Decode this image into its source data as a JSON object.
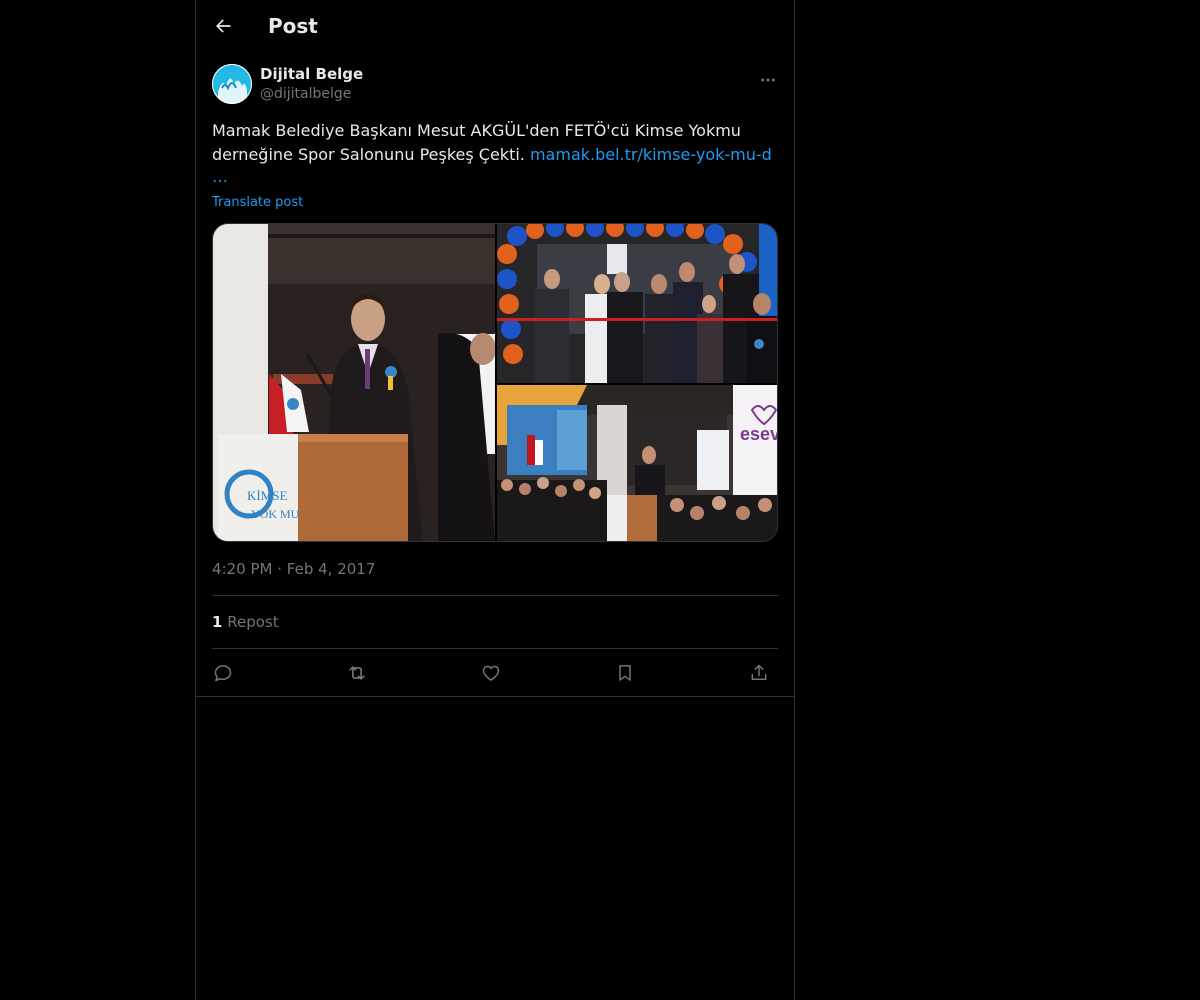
{
  "header": {
    "title": "Post"
  },
  "post": {
    "author_name": "Dijital Belge",
    "author_handle": "@dijitalbelge",
    "text": "Mamak Belediye Başkanı Mesut AKGÜL'den FETÖ'cü Kimse Yokmu derneğine Spor Salonunu Peşkeş Çekti.",
    "link_text": "mamak.bel.tr/kimse-yok-mu-d",
    "ellipsis": "…",
    "translate_label": "Translate post",
    "time": "4:20 PM",
    "separator": "·",
    "date": "Feb 4, 2017"
  },
  "media": {
    "photo_1_caption_line1": "KİMSE",
    "photo_1_caption_line2": "YOK MU",
    "photo_3_sign": "esev"
  },
  "stats": {
    "repost_count": "1",
    "repost_label": "Repost"
  },
  "actions": {
    "icons": [
      "reply-icon",
      "repost-icon",
      "like-icon",
      "bookmark-icon",
      "share-icon"
    ]
  },
  "colors": {
    "background": "#000000",
    "text": "#e7e9ea",
    "secondary": "#71767b",
    "accent": "#1d9bf0",
    "border": "#2f3336"
  }
}
